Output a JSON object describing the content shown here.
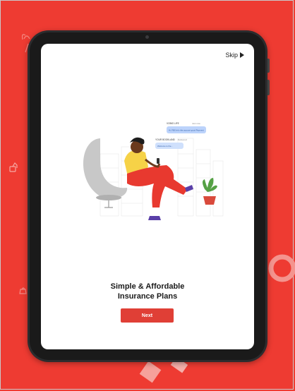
{
  "app": {
    "skip_label": "Skip",
    "headline_line1": "Simple & Affordable",
    "headline_line2": "Insurance Plans",
    "next_label": "Next"
  },
  "illustration": {
    "chat_1_header": "VOBIO LIFE",
    "chat_1_status": "Just now",
    "chat_1_message": "Hi, FBS let's this account good Payment",
    "chat_2_header": "YOUR BOOKLAND",
    "chat_2_status": "Delivered",
    "chat_2_message": "Welcome to the..."
  },
  "colors": {
    "background": "#ee3b32",
    "accent": "#e03f36",
    "chat_bubble": "#3b82f6",
    "person_shirt": "#f6d247",
    "person_pants": "#e8392f"
  },
  "icons": {
    "skip": "play-arrow-icon"
  }
}
